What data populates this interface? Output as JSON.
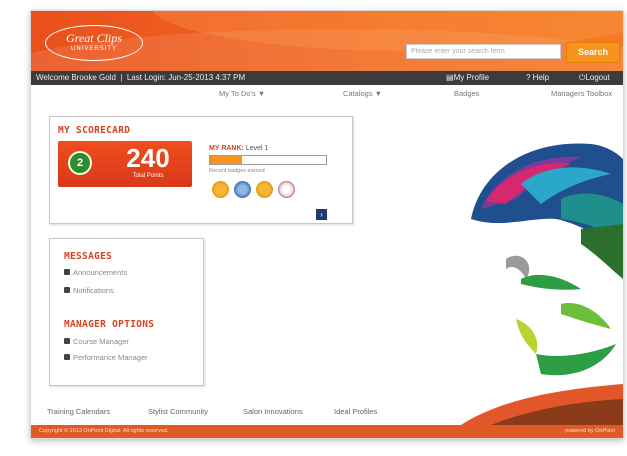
{
  "brand": {
    "logo_line1": "Great Clips",
    "logo_line2": "UNIVERSITY"
  },
  "search": {
    "placeholder": "Please enter your search term",
    "button": "Search"
  },
  "userbar": {
    "welcome": "Welcome Brooke Gold",
    "last_login": "Last Login: Jun-25-2013 4:37 PM",
    "my_profile": "My Profile",
    "help": "? Help",
    "logout": "Logout"
  },
  "nav": [
    "My To Do's ▼",
    "Catalogs ▼",
    "Badges",
    "Managers Toolbox"
  ],
  "scorecard": {
    "title": "MY SCORECARD",
    "level": "2",
    "points": "240",
    "points_label": "Total Points",
    "rank_label": "MY RANK:",
    "rank_value": "Level 1",
    "rank_progress": 0.28,
    "rank_sub": "Recent badges earned",
    "badges": [
      "trophy-badge",
      "globe-badge",
      "star-badge",
      "red-ribbon-badge"
    ]
  },
  "messages": {
    "title": "MESSAGES",
    "items": [
      "Announcements",
      "Notifications"
    ]
  },
  "manager": {
    "title": "MANAGER OPTIONS",
    "items": [
      "Course Manager",
      "Performance Manager"
    ]
  },
  "bottom_links": [
    "Training Calendars",
    "Stylist Community",
    "Salon Innovations",
    "Ideal Profiles"
  ],
  "footer": {
    "copyright": "Copyright © 2013 OnPoint Digital. All rights reserved.",
    "powered": "powered by OnPoint"
  },
  "colors": {
    "brand_orange": "#f26a21",
    "accent_red": "#d9411e",
    "user_bar": "#3c3c3c"
  }
}
